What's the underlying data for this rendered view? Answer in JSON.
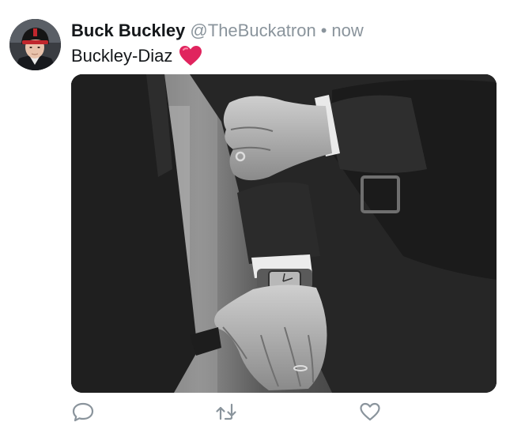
{
  "tweet": {
    "author_name": "Buck Buckley",
    "author_handle": "@TheBuckatron",
    "separator": "•",
    "timestamp": "now",
    "text": "Buckley-Diaz",
    "emoji": "red-heart-emoji",
    "media": {
      "kind": "photo",
      "subject": "two men in dark suits holding hands, black and white"
    }
  },
  "actions": {
    "icons": [
      "reply-icon",
      "retweet-icon",
      "like-icon"
    ]
  },
  "colors": {
    "name": "#14171a",
    "secondary": "#8a949c",
    "icon": "#8a949c",
    "heart": "#e0245e"
  }
}
